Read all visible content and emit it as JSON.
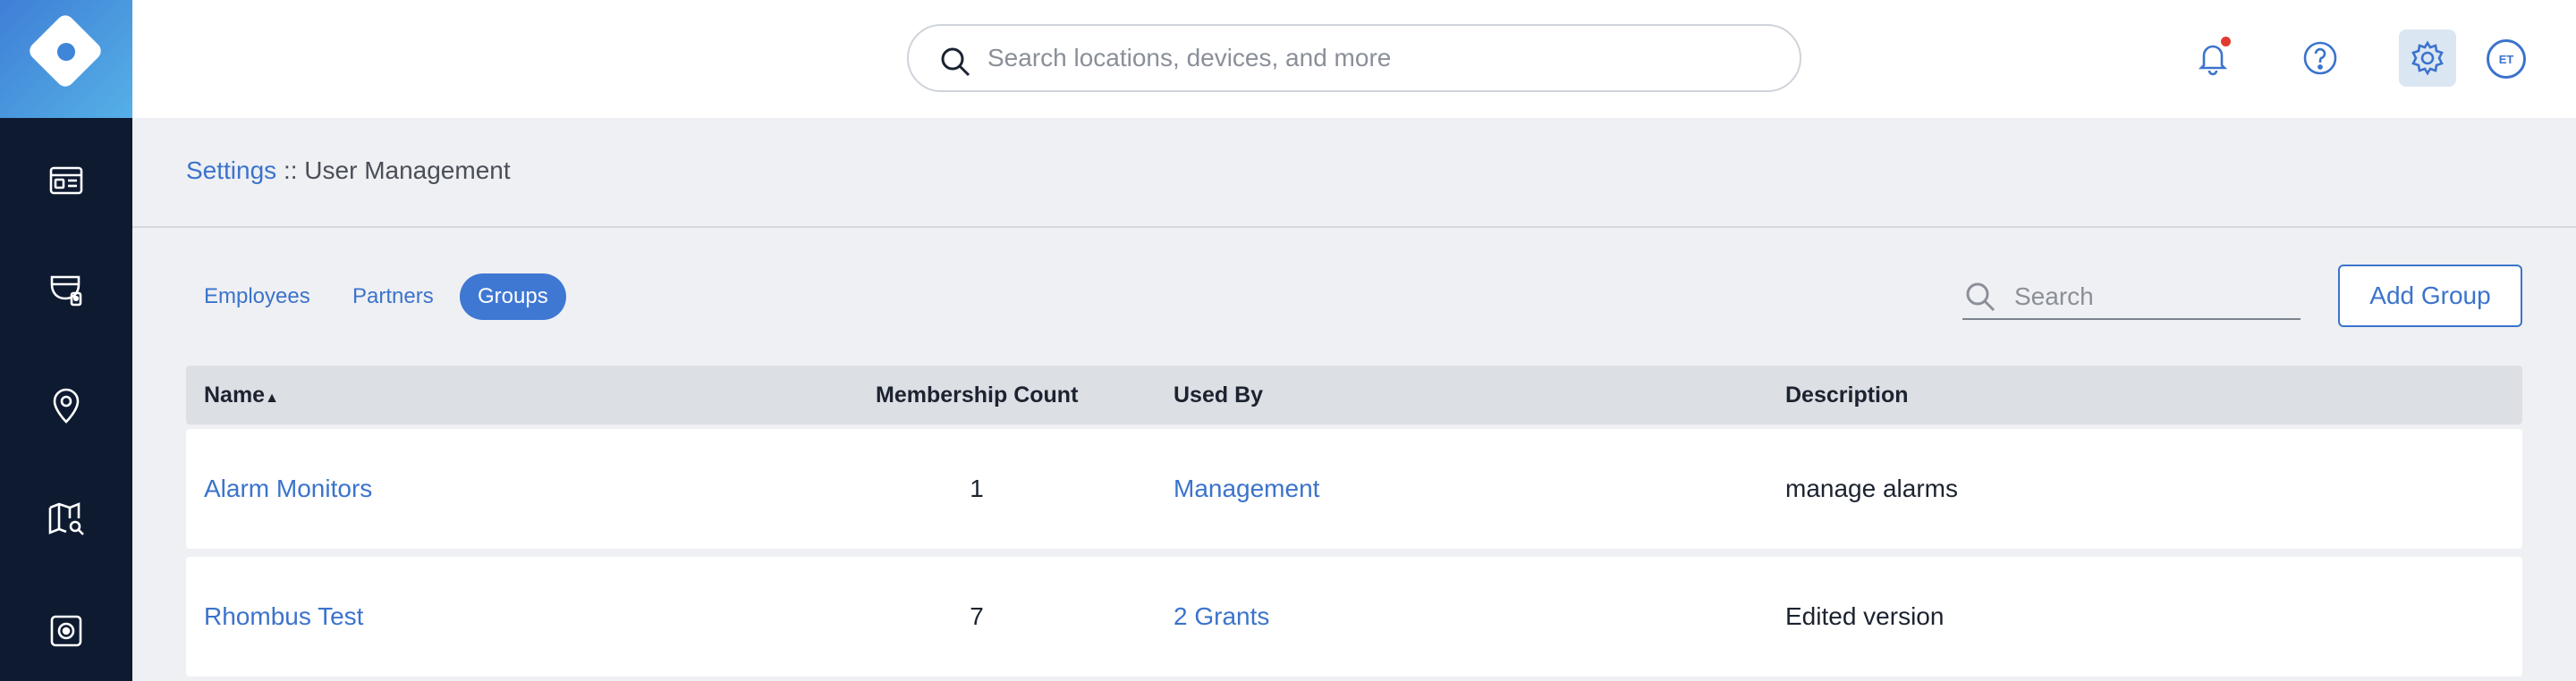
{
  "topbar": {
    "search_placeholder": "Search locations, devices, and more",
    "avatar_initials": "ET"
  },
  "breadcrumb": {
    "parent": "Settings",
    "separator": " :: ",
    "current": "User Management"
  },
  "tabs": [
    {
      "label": "Employees",
      "active": false
    },
    {
      "label": "Partners",
      "active": false
    },
    {
      "label": "Groups",
      "active": true
    }
  ],
  "toolbar": {
    "search_placeholder": "Search",
    "add_label": "Add Group"
  },
  "table": {
    "columns": [
      {
        "label": "Name",
        "sort": "▲"
      },
      {
        "label": "Membership Count"
      },
      {
        "label": "Used By"
      },
      {
        "label": "Description"
      }
    ],
    "rows": [
      {
        "name": "Alarm Monitors",
        "count": "1",
        "used_by": "Management",
        "description": "manage alarms"
      },
      {
        "name": "Rhombus Test",
        "count": "7",
        "used_by": "2 Grants",
        "description": "Edited version"
      }
    ]
  },
  "colors": {
    "accent": "#3b73cc",
    "sidebar": "#0e1a30",
    "notification": "#e03b2f"
  },
  "icons": {
    "sidebar": [
      "dashboard-icon",
      "camera-icon",
      "location-pin-icon",
      "map-search-icon",
      "sensor-icon"
    ],
    "topbar": [
      "bell-icon",
      "help-icon",
      "gear-icon"
    ]
  }
}
